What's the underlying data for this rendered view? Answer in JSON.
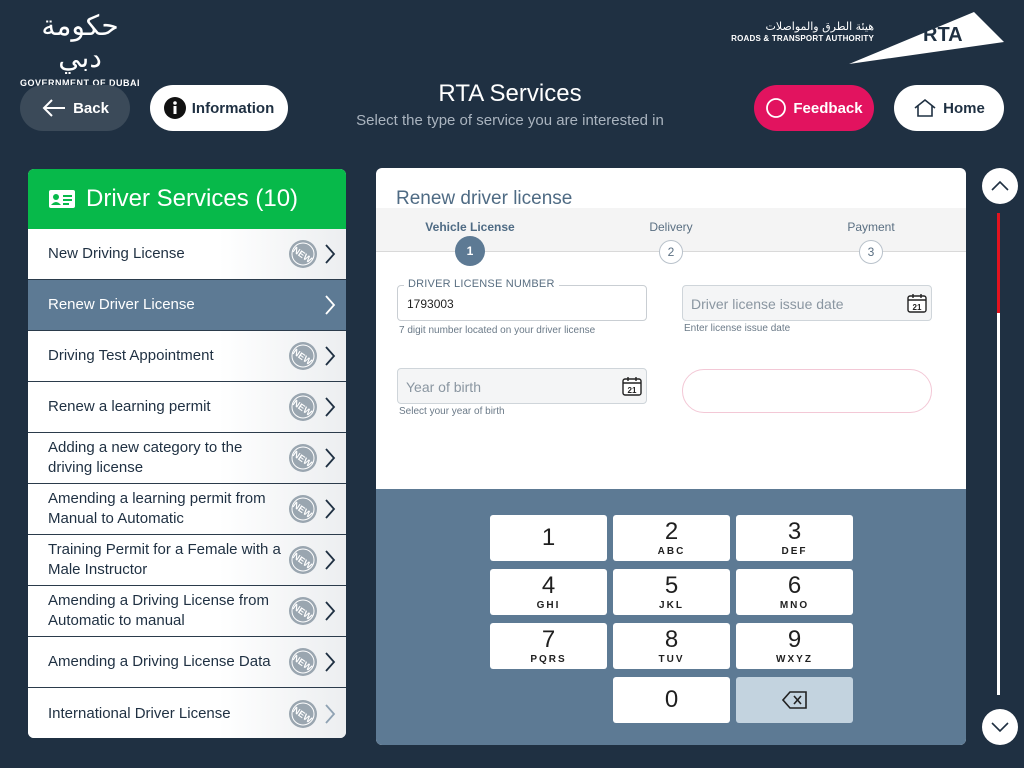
{
  "header": {
    "gov_arabic": "حكومة دبي",
    "gov_english": "GOVERNMENT OF DUBAI",
    "rta_arabic": "هيئة الطرق والمواصلات",
    "rta_english": "ROADS & TRANSPORT AUTHORITY",
    "rta_mark": "RTA",
    "title": "RTA Services",
    "subtitle": "Select the type of service you are interested  in",
    "back_label": "Back",
    "info_label": "Information",
    "feedback_label": "Feedback",
    "home_label": "Home"
  },
  "colors": {
    "background": "#1f3042",
    "accent_green": "#07b94a",
    "feedback_pink": "#e2135f",
    "active_item": "#5d7a94",
    "scroll_thumb": "#e2131f"
  },
  "sidebar": {
    "title": "Driver Services (10)",
    "icon": "id-card-icon",
    "items": [
      {
        "label": "New Driving License",
        "badge": "NEW"
      },
      {
        "label": "Renew Driver License",
        "active": true
      },
      {
        "label": "Driving Test Appointment",
        "badge": "NEW"
      },
      {
        "label": "Renew a learning permit",
        "badge": "NEW"
      },
      {
        "label": "Adding a new category to the driving license",
        "badge": "NEW"
      },
      {
        "label": "Amending a learning permit from Manual to Automatic",
        "badge": "NEW"
      },
      {
        "label": "Training Permit for a Female with a Male Instructor",
        "badge": "NEW"
      },
      {
        "label": "Amending a Driving License from Automatic to manual",
        "badge": "NEW"
      },
      {
        "label": "Amending a Driving License Data",
        "badge": "NEW"
      },
      {
        "label": "International Driver License",
        "badge": "NEW"
      }
    ]
  },
  "form": {
    "title": "Renew driver license",
    "steps": [
      {
        "label": "Vehicle License",
        "num": "1",
        "active": true
      },
      {
        "label": "Delivery",
        "num": "2"
      },
      {
        "label": "Payment",
        "num": "3"
      }
    ],
    "license_number_label": "DRIVER LICENSE NUMBER",
    "license_number_value": "1793003",
    "license_number_hint": "7 digit number located on your driver license",
    "issue_date_placeholder": "Driver license issue date",
    "issue_date_hint": "Enter license issue date",
    "yob_placeholder": "Year of birth",
    "yob_hint": "Select your year of birth",
    "calendar_day": "21"
  },
  "keypad": {
    "keys": [
      {
        "digit": "1",
        "letters": ""
      },
      {
        "digit": "2",
        "letters": "ABC"
      },
      {
        "digit": "3",
        "letters": "DEF"
      },
      {
        "digit": "4",
        "letters": "GHI"
      },
      {
        "digit": "5",
        "letters": "JKL"
      },
      {
        "digit": "6",
        "letters": "MNO"
      },
      {
        "digit": "7",
        "letters": "PQRS"
      },
      {
        "digit": "8",
        "letters": "TUV"
      },
      {
        "digit": "9",
        "letters": "WXYZ"
      },
      {
        "digit": "0",
        "letters": ""
      }
    ],
    "delete_icon": "backspace-icon"
  },
  "scrollbar": {
    "position": 0
  }
}
